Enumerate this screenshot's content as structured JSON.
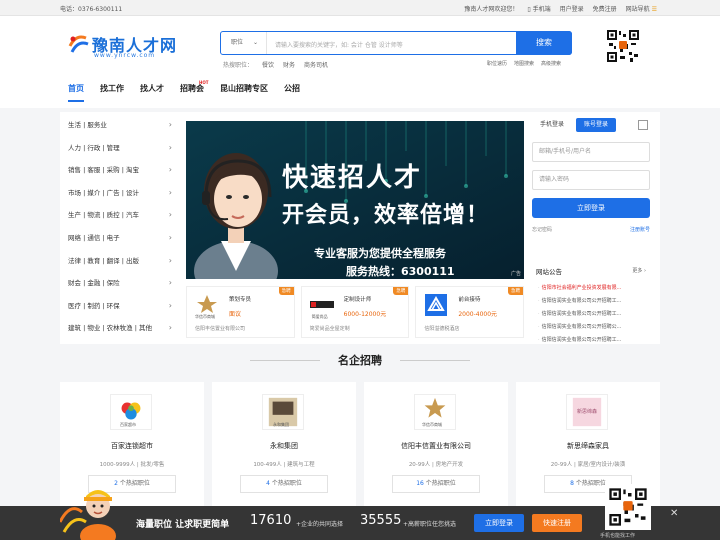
{
  "topbar": {
    "phone": "电话：0376-6300111",
    "welcome": "豫南人才网欢迎您！",
    "mobile": "手机端",
    "user_login": "用户登录",
    "free_register": "免费注册",
    "site_nav": "网站导航"
  },
  "logo": {
    "cn": "豫南人才网",
    "en": "www.ynrcw.com"
  },
  "search": {
    "category": "职位",
    "placeholder": "请输入要搜索的关键字，如: 会计 仓管 设计师等",
    "button": "搜索",
    "hot_label": "热搜职位：",
    "hot_items": [
      "餐饮",
      "财务",
      "商务司机"
    ],
    "links": [
      "职位速历",
      "地图搜索",
      "高级搜索"
    ]
  },
  "nav": {
    "items": [
      "首页",
      "找工作",
      "找人才",
      "招聘会",
      "昆山招聘专区",
      "公招"
    ],
    "hot_badge": "HOT"
  },
  "categories": [
    "生活 | 服务业",
    "人力 | 行政 | 管理",
    "销售 | 客服 | 采购 | 淘宝",
    "市场 | 媒介 | 广告 | 设计",
    "生产 | 物流 | 质控 | 汽车",
    "网络 | 通信 | 电子",
    "法律 | 教育 | 翻译 | 出版",
    "财会 | 金融 | 保险",
    "医疗 | 制药 | 环保",
    "建筑 | 物业 | 农林牧渔 | 其他"
  ],
  "banner": {
    "title": "快速招人才",
    "subtitle": "开会员，效率倍增！",
    "line1": "专业客服为您提供全程服务",
    "line2": "服务热线：6300111",
    "ad": "广告"
  },
  "featured_jobs": [
    {
      "title": "策划专员",
      "salary": "面议",
      "company": "信阳丰信置业有限公司",
      "badge": "急聘",
      "logo_text": "华信币商城"
    },
    {
      "title": "定制设计师",
      "salary": "6000-12000元",
      "company": "简爱尚品全屋定制",
      "badge": "急聘",
      "logo_text": "简爱尚品"
    },
    {
      "title": "前台接待",
      "salary": "2000-4000元",
      "company": "信阳溢德税酒店",
      "badge": "急聘",
      "logo_text": ""
    }
  ],
  "login": {
    "tab_phone": "手机登录",
    "tab_account": "账号登录",
    "account_placeholder": "邮箱/手机号/用户名",
    "password_placeholder": "请输入密码",
    "submit": "立即登录",
    "forgot": "忘记密码",
    "register": "注册账号"
  },
  "notice": {
    "title": "网站公告",
    "more": "更多",
    "items": [
      "信阳市社会福利产业投资发展有限...",
      "信阳信润实业有限公司公开招聘工...",
      "信阳信润实业有限公司公开招聘工...",
      "信阳信润实业有限公司公开招聘公...",
      "信阳信润实业有限公司公开招聘工..."
    ]
  },
  "section_title": "名企招聘",
  "companies": [
    {
      "name": "百家连锁超市",
      "size": "1000-9999人",
      "industry": "批发/零售",
      "hot_count": "2",
      "hot_label": "个热招职位",
      "logo_text": "百家超市"
    },
    {
      "name": "永和集团",
      "size": "100-499人",
      "industry": "建筑与工程",
      "hot_count": "4",
      "hot_label": "个热招职位",
      "logo_text": "永和集团"
    },
    {
      "name": "信阳丰信置业有限公司",
      "size": "20-99人",
      "industry": "房地产开发",
      "hot_count": "16",
      "hot_label": "个热招职位",
      "logo_text": "华信币商城"
    },
    {
      "name": "新思缔森家具",
      "size": "20-99人",
      "industry": "家居/室内设计/装潢",
      "hot_count": "8",
      "hot_label": "个热招职位",
      "logo_text": "新思缔森"
    }
  ],
  "footer_bar": {
    "slogan": "海量职位 让求职更简单",
    "num1": "17610",
    "text1": "+企业的共同选择",
    "num2": "35555",
    "text2": "+高薪职位任您挑选",
    "login": "立即登录",
    "register": "快速注册",
    "qr_text": "手机也能找工作"
  },
  "colors": {
    "primary": "#1e6fe6",
    "accent_orange": "#f47a20",
    "badge": "#f08a24",
    "footer": "#353535"
  }
}
